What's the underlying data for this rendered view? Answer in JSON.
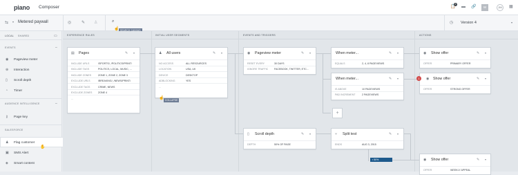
{
  "app": {
    "logo": "piano",
    "name": "Composer"
  },
  "topbar": {
    "notif_icon": "📋",
    "notif_count": "2",
    "folder_icon": "▬",
    "link_icon": "🔗",
    "btn_label": "W",
    "avatar": "JM",
    "grid_icon": "▦"
  },
  "subbar": {
    "page_name": "Metered paywall",
    "version": "Version 4",
    "search_tooltip": "SEARCH CANVAS"
  },
  "sidebar": {
    "tabs": [
      "LOCAL",
      "SHARED"
    ],
    "sections": [
      {
        "title": "EVENTS",
        "items": [
          "Pageview meter",
          "Interaction",
          "Scroll depth",
          "Timer"
        ]
      },
      {
        "title": "AUDIENCE INTELLIGENCE",
        "items": [
          "Page key"
        ]
      },
      {
        "title": "SALESFORCE",
        "items": [
          "Flag customer",
          "SMS Alert",
          "Smart content"
        ]
      }
    ]
  },
  "columns": [
    "EXPERIENCE RULES",
    "INITIAL USER SEGMENTS",
    "EVENTS AND TRIGGERS",
    "ACTIONS"
  ],
  "cards": {
    "pages": {
      "title": "Pages",
      "rows": [
        [
          "INCLUDE URLS",
          "/SPORTS/, /POLITICS/PRINT/"
        ],
        [
          "INCLUDE TAGS",
          "POLITICS, LOCAL, MUSIC, ..."
        ],
        [
          "INCLUDE ZONES",
          "ZONE 1, ZONE 2, ZONE 3"
        ],
        [
          "EXCLUDE URLS",
          "/BREAKING/, /NEWS/PRINT/"
        ],
        [
          "EXCLUDE TAGS",
          "CRIME, NEWS"
        ],
        [
          "EXCLUDE ZONES",
          "ZONE 4"
        ]
      ],
      "more": "..."
    },
    "allusers": {
      "title": "All users",
      "rows": [
        [
          "NO ACCESS",
          "ALL RESOURCES"
        ],
        [
          "LOCATION",
          "USA, UK"
        ],
        [
          "DEVICE",
          "DESKTOP"
        ],
        [
          "ADBLOCKING",
          "YES"
        ]
      ],
      "more": "...",
      "tooltip": "COLLAPSE"
    },
    "pvmeter": {
      "title": "Pageview meter",
      "rows": [
        [
          "RESET EVERY",
          "30 DAYS"
        ],
        [
          "IGNORE TRAFFIC",
          "FACEBOOK, TWITTER, ETC..."
        ]
      ]
    },
    "when1": {
      "title": "When meter...",
      "rows": [
        [
          "EQUALS",
          "2, 4, 8 PAGEVIEWS"
        ]
      ]
    },
    "when2": {
      "title": "When meter...",
      "rows": [
        [
          "IS ABOVE",
          "10 PAGEVIEWS"
        ],
        [
          "PAD INCREMENT",
          "2 PAGEVIEWS"
        ]
      ]
    },
    "offer1": {
      "title": "Show offer",
      "rows": [
        [
          "OFFER",
          "PRIMARY OFFER"
        ]
      ]
    },
    "offer2": {
      "title": "Show offer",
      "rows": [
        [
          "OFFER",
          "STRONG OFFER"
        ]
      ],
      "badge": "1"
    },
    "scroll": {
      "title": "Scroll depth",
      "rows": [
        [
          "DEPTH",
          "50% OF PAGE"
        ]
      ]
    },
    "split": {
      "title": "Split test",
      "rows": [
        [
          "ENDS",
          "AUG 3, 2015"
        ]
      ]
    },
    "offer3": {
      "title": "Show offer",
      "rows": [
        [
          "OFFER",
          "WEEKLY APPEAL"
        ]
      ]
    }
  },
  "progress": {
    "label": "50%",
    "value": 0.5
  },
  "colors": {
    "accent": "#1e5a8c",
    "alert": "#d24b4b"
  }
}
